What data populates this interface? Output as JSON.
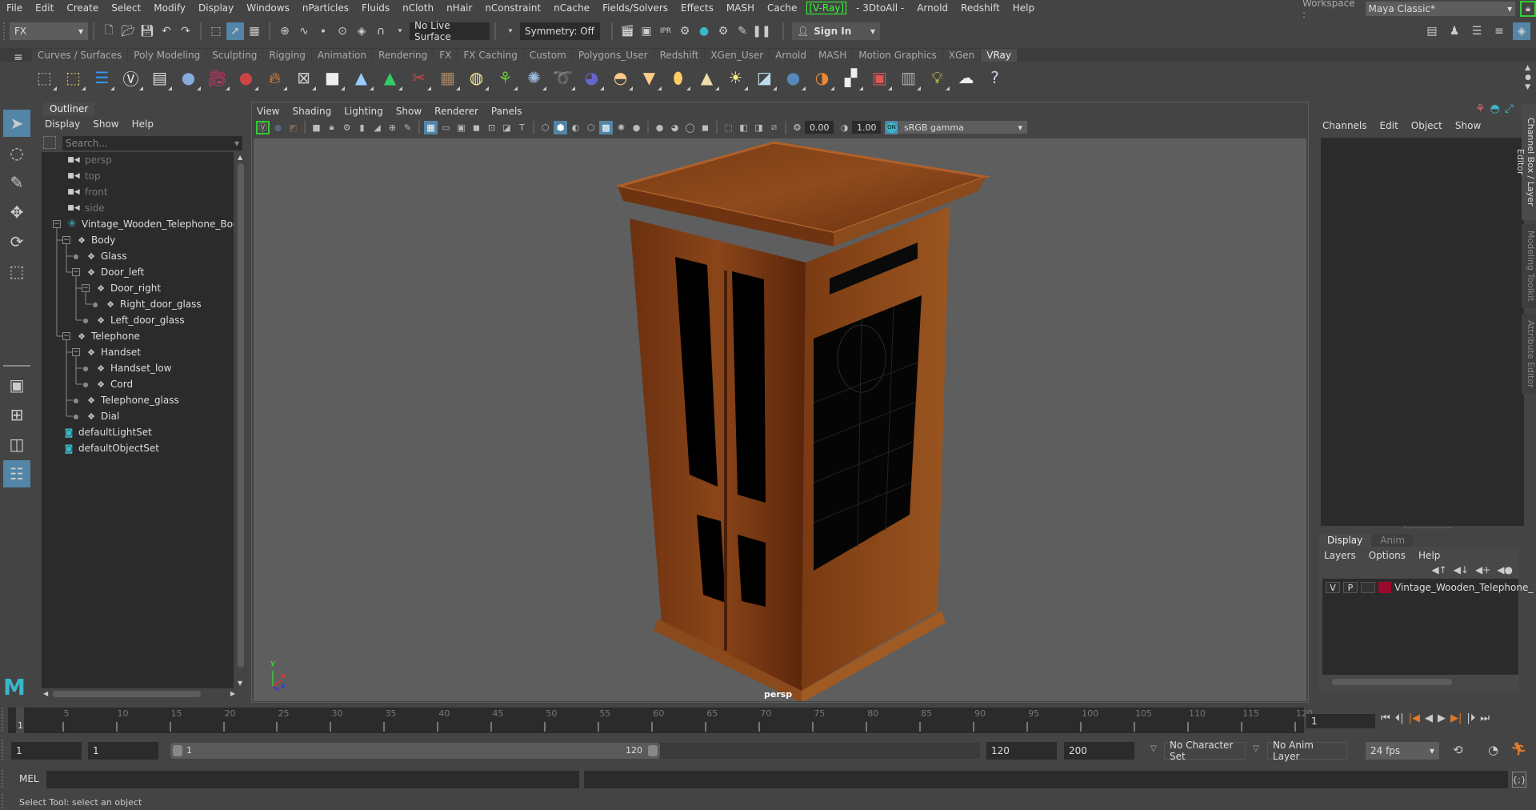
{
  "menubar": {
    "items": [
      "File",
      "Edit",
      "Create",
      "Select",
      "Modify",
      "Display",
      "Windows",
      "nParticles",
      "Fluids",
      "nCloth",
      "nHair",
      "nConstraint",
      "nCache",
      "Fields/Solvers",
      "Effects",
      "MASH",
      "Cache",
      "[V-Ray]",
      "- 3DtoAll -",
      "Arnold",
      "Redshift",
      "Help"
    ],
    "workspace_label": "Workspace :",
    "workspace_value": "Maya Classic*"
  },
  "statusline": {
    "menuset": "FX",
    "live_surface": "No Live Surface",
    "symmetry": "Symmetry: Off",
    "sign_in": "Sign In"
  },
  "shelf": {
    "tabs": [
      "Curves / Surfaces",
      "Poly Modeling",
      "Sculpting",
      "Rigging",
      "Animation",
      "Rendering",
      "FX",
      "FX Caching",
      "Custom",
      "Polygons_User",
      "Redshift",
      "XGen_User",
      "Arnold",
      "MASH",
      "Motion Graphics",
      "XGen",
      "VRay"
    ],
    "active_tab": "VRay"
  },
  "outliner": {
    "title": "Outliner",
    "menu": [
      "Display",
      "Show",
      "Help"
    ],
    "search_placeholder": "Search...",
    "nodes": [
      {
        "label": "persp",
        "type": "camera",
        "depth": 0,
        "dim": true
      },
      {
        "label": "top",
        "type": "camera",
        "depth": 0,
        "dim": true
      },
      {
        "label": "front",
        "type": "camera",
        "depth": 0,
        "dim": true
      },
      {
        "label": "side",
        "type": "camera",
        "depth": 0,
        "dim": true
      },
      {
        "label": "Vintage_Wooden_Telephone_Booth_",
        "type": "root",
        "depth": 0,
        "expanded": true
      },
      {
        "label": "Body",
        "type": "transform",
        "depth": 1,
        "expanded": true
      },
      {
        "label": "Glass",
        "type": "transform",
        "depth": 2
      },
      {
        "label": "Door_left",
        "type": "transform",
        "depth": 2,
        "expanded": true
      },
      {
        "label": "Door_right",
        "type": "transform",
        "depth": 3,
        "expanded": true
      },
      {
        "label": "Right_door_glass",
        "type": "transform",
        "depth": 4
      },
      {
        "label": "Left_door_glass",
        "type": "transform",
        "depth": 3
      },
      {
        "label": "Telephone",
        "type": "transform",
        "depth": 1,
        "expanded": true
      },
      {
        "label": "Handset",
        "type": "transform",
        "depth": 2,
        "expanded": true
      },
      {
        "label": "Handset_low",
        "type": "transform",
        "depth": 3
      },
      {
        "label": "Cord",
        "type": "transform",
        "depth": 3
      },
      {
        "label": "Telephone_glass",
        "type": "transform",
        "depth": 2
      },
      {
        "label": "Dial",
        "type": "transform",
        "depth": 2
      },
      {
        "label": "defaultLightSet",
        "type": "set",
        "depth": 0
      },
      {
        "label": "defaultObjectSet",
        "type": "set",
        "depth": 0
      }
    ]
  },
  "viewport": {
    "menu": [
      "View",
      "Shading",
      "Lighting",
      "Show",
      "Renderer",
      "Panels"
    ],
    "exposure": "0.00",
    "gamma": "1.00",
    "color_space_toggle": "ON",
    "color_space": "sRGB gamma",
    "camera_label": "persp",
    "axis": {
      "x": "x",
      "y": "y",
      "z": "z"
    }
  },
  "channelbox": {
    "menu": [
      "Channels",
      "Edit",
      "Object",
      "Show"
    ],
    "layer_tabs": [
      "Display",
      "Anim"
    ],
    "active_layer_tab": "Display",
    "layer_menu": [
      "Layers",
      "Options",
      "Help"
    ],
    "layers": [
      {
        "v": "V",
        "p": "P",
        "name": "Vintage_Wooden_Telephone_",
        "color": "#9b0a2a"
      }
    ]
  },
  "side_tabs": [
    "Channel Box / Layer Editor",
    "Modeling Toolkit",
    "Attribute Editor"
  ],
  "timeline": {
    "ticks": [
      5,
      10,
      15,
      20,
      25,
      30,
      35,
      40,
      45,
      50,
      55,
      60,
      65,
      70,
      75,
      80,
      85,
      90,
      95,
      100,
      105,
      110,
      115,
      120
    ],
    "start": 1,
    "end": 120,
    "current_frame": "1",
    "current_frame_field": "1"
  },
  "range": {
    "start_field": "1",
    "playback_start_field": "1",
    "range_start_label": "1",
    "range_end_label": "120",
    "playback_end_field": "120",
    "end_field": "200",
    "character_set": "No Character Set",
    "anim_layer": "No Anim Layer",
    "fps": "24 fps"
  },
  "commandline": {
    "label": "MEL"
  },
  "helpline": {
    "text": "Select Tool: select an object"
  },
  "colors": {
    "accent": "#5285a6",
    "vray_green": "#33ff33",
    "maya_teal": "#39b8c8",
    "key_orange": "#e07a2a"
  }
}
